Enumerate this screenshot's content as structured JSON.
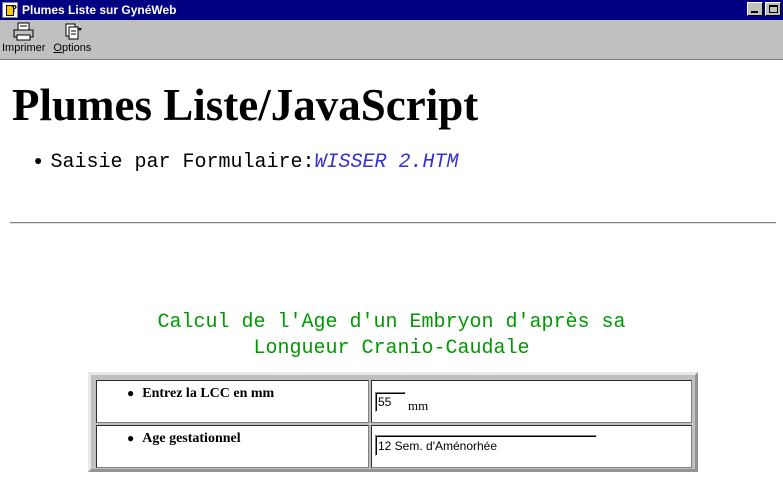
{
  "window": {
    "title": "Plumes Liste sur GynéWeb"
  },
  "toolbar": {
    "print_label": "Imprimer",
    "options_label_first": "O",
    "options_label_rest": "ptions"
  },
  "page": {
    "title": "Plumes Liste/JavaScript",
    "bullet_text": "Saisie par Formulaire:",
    "bullet_link": "WISSER 2.HTM"
  },
  "calculator": {
    "title_line1": "Calcul de l'Age d'un Embryon d'après sa",
    "title_line2": "Longueur Cranio-Caudale",
    "lcc_label": "Entrez la LCC en mm",
    "lcc_value": "55",
    "lcc_unit": "mm",
    "age_label": "Age gestationnel",
    "age_value": "12 Sem. d'Aménorhée"
  },
  "icons": {
    "app": "gyneweb-app-icon",
    "print": "printer-icon",
    "options": "options-icon"
  },
  "colors": {
    "titlebar": "#000080",
    "link": "#3333cc",
    "calc_title": "#009900"
  }
}
